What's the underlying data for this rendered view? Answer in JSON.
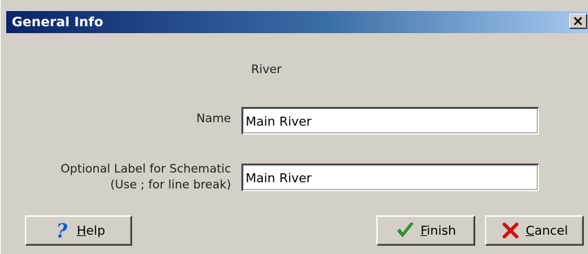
{
  "window": {
    "title": "General Info",
    "close_glyph": "×"
  },
  "form": {
    "object_type": "River",
    "name_label": "Name",
    "name_value": "Main River",
    "optional_label_line1": "Optional Label for Schematic",
    "optional_label_line2": "(Use ; for line break)",
    "optional_label_value": "Main River"
  },
  "buttons": {
    "help_label": "Help",
    "help_icon": "question-mark-icon",
    "finish_label": "Finish",
    "finish_icon": "checkmark-icon",
    "cancel_label": "Cancel",
    "cancel_icon": "red-x-icon"
  },
  "colors": {
    "title_bar_start": "#0a246a",
    "title_bar_end": "#a6caf0",
    "dialog_background": "#d4d0c8",
    "help_icon_color": "#1060d0",
    "finish_icon_color": "#2fa52f",
    "cancel_icon_color": "#d01010"
  }
}
